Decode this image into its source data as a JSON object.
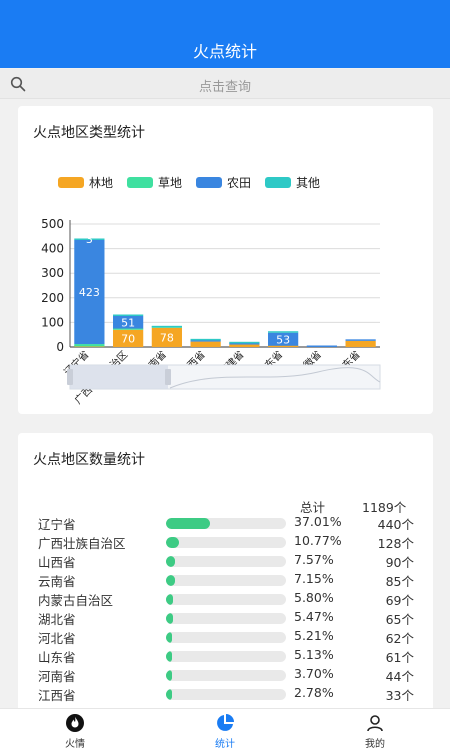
{
  "header": {
    "title": "火点统计"
  },
  "search": {
    "placeholder": "点击查询"
  },
  "type_card": {
    "title": "火点地区类型统计",
    "legend": [
      {
        "label": "林地",
        "color": "#f5a623"
      },
      {
        "label": "草地",
        "color": "#3fe0a0"
      },
      {
        "label": "农田",
        "color": "#3a86e0"
      },
      {
        "label": "其他",
        "color": "#2ec9c6"
      }
    ]
  },
  "chart_data": {
    "type": "bar",
    "categories": [
      "辽宁省",
      "广西壮族自治区",
      "云南省",
      "江西省",
      "福建省",
      "山东省",
      "安徽省",
      "广东省"
    ],
    "series": [
      {
        "name": "林地",
        "values": [
          2,
          70,
          78,
          22,
          10,
          5,
          0,
          25
        ]
      },
      {
        "name": "草地",
        "values": [
          10,
          5,
          2,
          0,
          0,
          0,
          0,
          0
        ]
      },
      {
        "name": "农田",
        "values": [
          423,
          51,
          0,
          5,
          5,
          53,
          5,
          4
        ]
      },
      {
        "name": "其他",
        "values": [
          3,
          2,
          5,
          3,
          2,
          3,
          0,
          0
        ]
      }
    ],
    "data_labels": [
      [
        "",
        "70",
        "78",
        "",
        "",
        "",
        "",
        ""
      ],
      [
        "",
        "",
        "",
        "",
        "",
        "",
        "",
        ""
      ],
      [
        "423",
        "51",
        "",
        "",
        "",
        "53",
        "",
        ""
      ],
      [
        "3",
        "",
        "",
        "",
        "",
        "",
        "",
        ""
      ]
    ],
    "yticks": [
      "0",
      "100",
      "200",
      "300",
      "400",
      "500"
    ],
    "ylim": [
      0,
      500
    ],
    "stacked": true,
    "grid": true
  },
  "count_card": {
    "title": "火点地区数量统计",
    "total_label": "总计",
    "total_value": "1189个",
    "rows": [
      {
        "name": "辽宁省",
        "pct": "37.01%",
        "count": "440个",
        "ratio": 0.3701
      },
      {
        "name": "广西壮族自治区",
        "pct": "10.77%",
        "count": "128个",
        "ratio": 0.1077
      },
      {
        "name": "山西省",
        "pct": "7.57%",
        "count": "90个",
        "ratio": 0.0757
      },
      {
        "name": "云南省",
        "pct": "7.15%",
        "count": "85个",
        "ratio": 0.0715
      },
      {
        "name": "内蒙古自治区",
        "pct": "5.80%",
        "count": "69个",
        "ratio": 0.058
      },
      {
        "name": "湖北省",
        "pct": "5.47%",
        "count": "65个",
        "ratio": 0.0547
      },
      {
        "name": "河北省",
        "pct": "5.21%",
        "count": "62个",
        "ratio": 0.0521
      },
      {
        "name": "山东省",
        "pct": "5.13%",
        "count": "61个",
        "ratio": 0.0513
      },
      {
        "name": "河南省",
        "pct": "3.70%",
        "count": "44个",
        "ratio": 0.037
      },
      {
        "name": "江西省",
        "pct": "2.78%",
        "count": "33个",
        "ratio": 0.0278
      }
    ]
  },
  "tabbar": {
    "tabs": [
      {
        "label": "火情",
        "icon": "fire-icon"
      },
      {
        "label": "统计",
        "icon": "pie-chart-icon"
      },
      {
        "label": "我的",
        "icon": "user-icon"
      }
    ]
  }
}
